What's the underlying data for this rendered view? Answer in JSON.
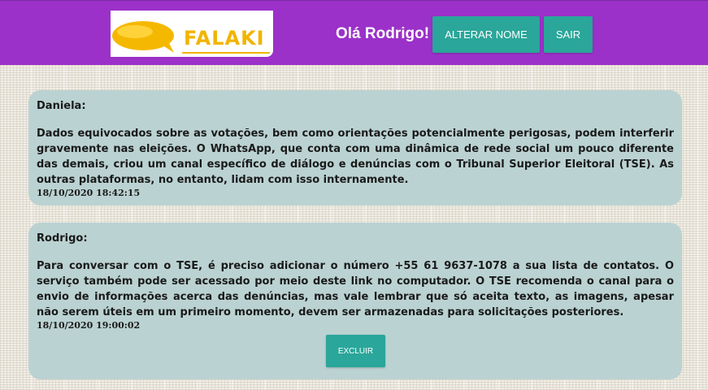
{
  "header": {
    "logo_text": "FALAKI",
    "greeting": "Olá Rodrigo!",
    "rename_button": "ALTERAR NOME",
    "exit_button": "SAIR"
  },
  "messages": [
    {
      "author": "Daniela:",
      "text": "Dados equivocados sobre as votações, bem como orientações potencialmente perigosas, podem interferir gravemente nas eleições. O WhatsApp, que conta com uma dinâmica de rede social um pouco diferente das demais, criou um canal específico de diálogo e denúncias com o Tribunal Superior Eleitoral (TSE). As outras plataformas, no entanto, lidam com isso internamente.",
      "timestamp": "18/10/2020 18:42:15"
    },
    {
      "author": "Rodrigo:",
      "text": "Para conversar com o TSE, é preciso adicionar o número +55 61 9637-1078 a sua lista de contatos. O serviço também pode ser acessado por meio deste link no computador. O TSE recomenda o canal para o envio de informações acerca das denúncias, mas vale lembrar que só aceita texto, as imagens, apesar não serem úteis em um primeiro momento, devem ser armazenadas para solicitações posteriores.",
      "timestamp": "18/10/2020 19:00:02",
      "delete_button": "EXCLUIR"
    }
  ],
  "colors": {
    "header_bg": "#9b31c9",
    "button_bg": "#2aa69a",
    "card_bg": "#bbd2d2",
    "logo_yellow": "#f2b400"
  },
  "icons": {
    "logo": "speech-bubble-icon"
  }
}
